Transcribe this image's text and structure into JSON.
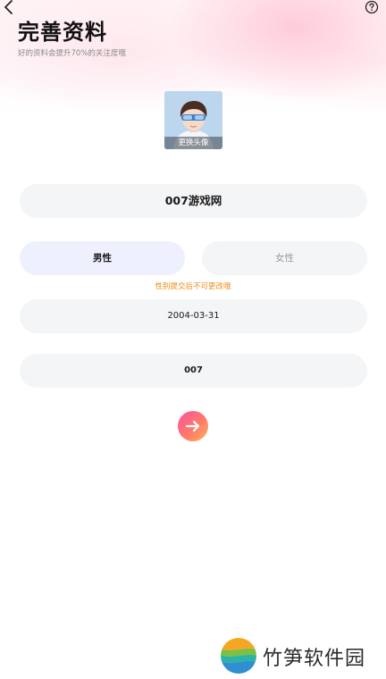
{
  "header": {
    "title": "完善资料",
    "subtitle": "好的资料会提升70%的关注度哦",
    "back_icon": "chevron-left-icon",
    "help_icon": "question-circle-icon"
  },
  "avatar": {
    "caption": "更换头像"
  },
  "form": {
    "nickname": "007游戏网",
    "gender": {
      "male_label": "男性",
      "female_label": "女性",
      "selected": "男性",
      "note": "性别提交后不可更改哦"
    },
    "birthday": "2004-03-31",
    "code": "007"
  },
  "next_button": {
    "icon": "arrow-right-icon"
  },
  "watermark": {
    "text": "竹笋软件园"
  },
  "colors": {
    "accent_orange": "#f08a1c",
    "selected_bg": "#eef0fe",
    "field_bg": "#f4f5f7",
    "next_gradient_start": "#ff4fa3",
    "next_gradient_end": "#ffb259"
  }
}
